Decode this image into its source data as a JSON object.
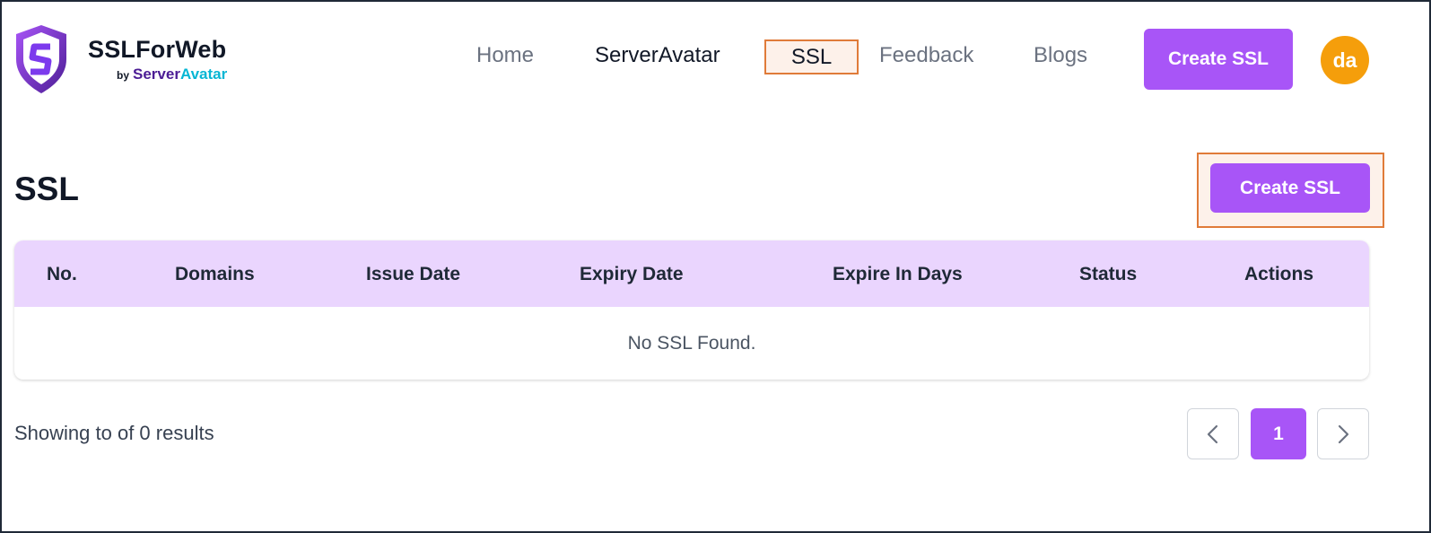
{
  "brand": {
    "title": "SSLForWeb",
    "by": "by",
    "sub_server": "Server",
    "sub_avatar": "Avatar"
  },
  "nav": {
    "home": "Home",
    "serveravatar": "ServerAvatar",
    "ssl": "SSL",
    "feedback": "Feedback",
    "blogs": "Blogs"
  },
  "header": {
    "create_button": "Create SSL",
    "avatar_initials": "da"
  },
  "page": {
    "title": "SSL",
    "create_button": "Create SSL"
  },
  "table": {
    "columns": [
      "No.",
      "Domains",
      "Issue Date",
      "Expiry Date",
      "Expire In Days",
      "Status",
      "Actions"
    ],
    "empty_message": "No SSL Found."
  },
  "footer": {
    "results_text": "Showing to of 0 results",
    "current_page": "1"
  },
  "colors": {
    "accent": "#a855f7",
    "header_row": "#ead5fe",
    "avatar": "#f59e0b",
    "highlight_border": "#e07b39"
  },
  "icons": {
    "logo": "shield-s-logo",
    "prev": "chevron-left-icon",
    "next": "chevron-right-icon"
  }
}
